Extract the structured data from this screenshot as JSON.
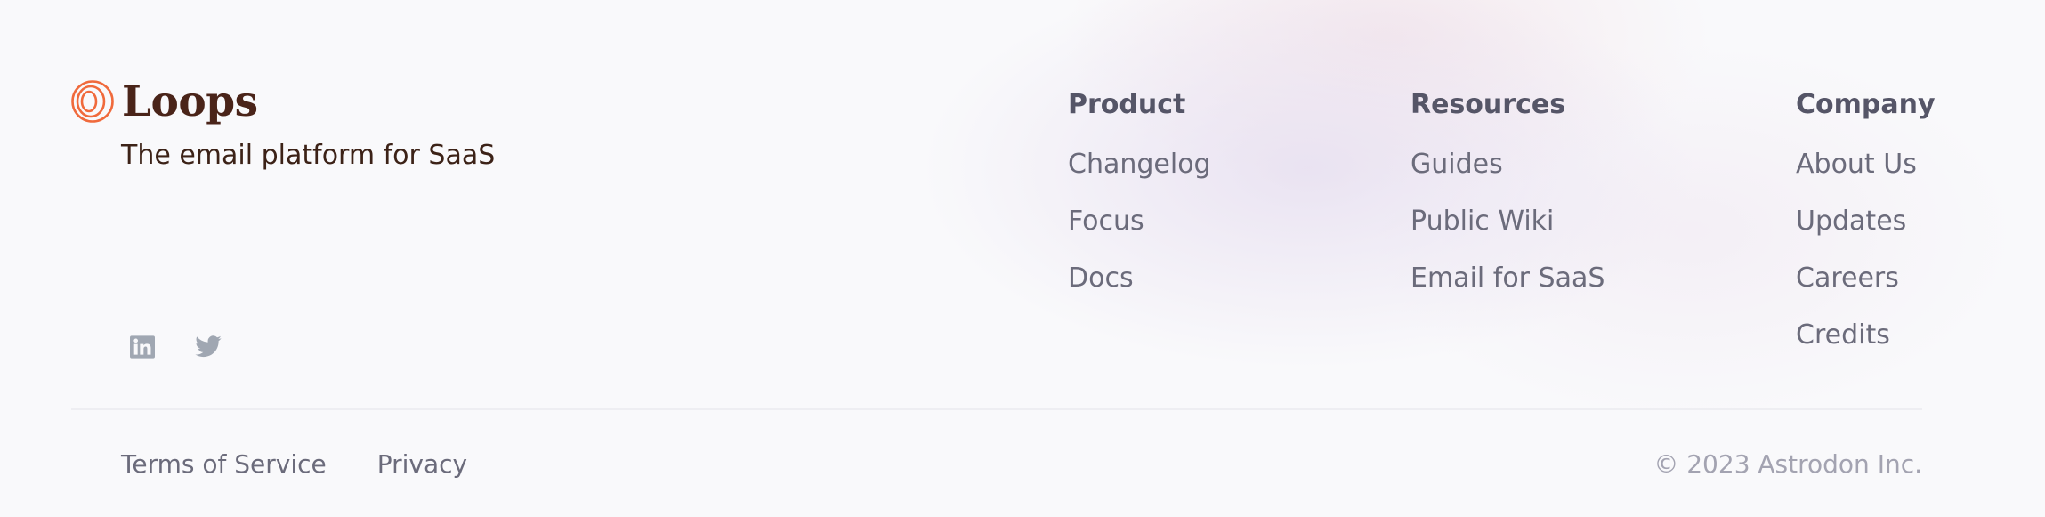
{
  "brand": {
    "name": "Loops",
    "tagline": "The email platform for SaaS",
    "logo_color": "#f06a3c",
    "name_color": "#4a2419"
  },
  "social": [
    {
      "icon": "linkedin-icon",
      "label": "LinkedIn"
    },
    {
      "icon": "twitter-icon",
      "label": "Twitter"
    }
  ],
  "columns": {
    "product": {
      "heading": "Product",
      "links": [
        "Changelog",
        "Focus",
        "Docs"
      ]
    },
    "resources": {
      "heading": "Resources",
      "links": [
        "Guides",
        "Public Wiki",
        "Email for SaaS"
      ]
    },
    "company": {
      "heading": "Company",
      "links": [
        "About Us",
        "Updates",
        "Careers",
        "Credits"
      ]
    }
  },
  "legal": {
    "terms": "Terms of Service",
    "privacy": "Privacy"
  },
  "copyright": "© 2023 Astrodon Inc.",
  "colors": {
    "heading": "#555567",
    "link": "#6b6b7b",
    "muted": "#a3a3b1",
    "icon": "#a0a7b2"
  }
}
